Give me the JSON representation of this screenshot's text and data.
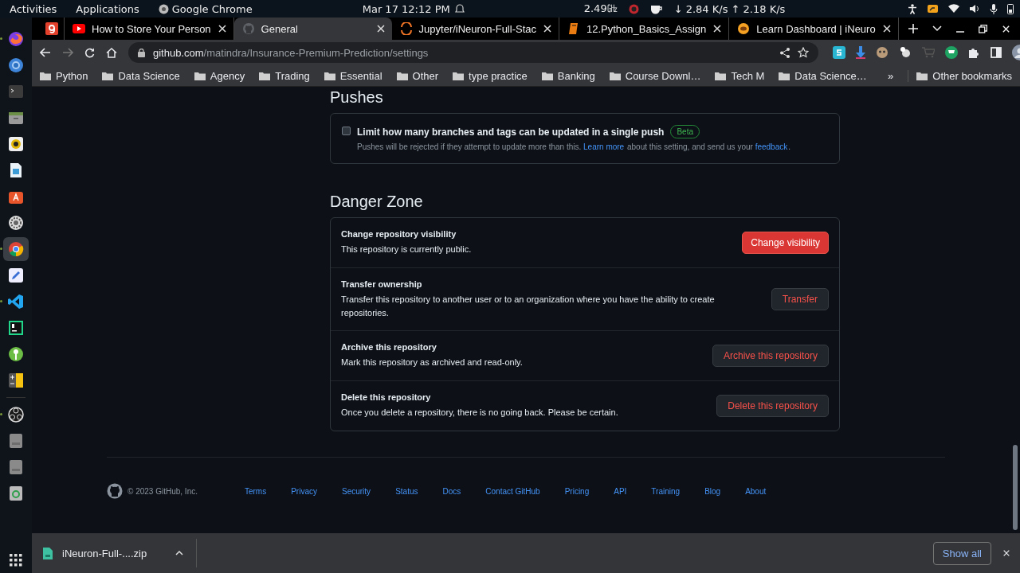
{
  "system_bar": {
    "menus": [
      "Activities",
      "Applications"
    ],
    "app": "Google Chrome",
    "clock": "Mar 17  12:12 PM",
    "cpu": "2.49㎓",
    "network": "↓ 2.84 K/s ↑ 2.18 K/s"
  },
  "dock": [
    {
      "kind": "fox",
      "running": true,
      "selected": false
    },
    {
      "kind": "globe",
      "running": false,
      "selected": false
    },
    {
      "kind": "terminal",
      "running": false,
      "selected": false
    },
    {
      "kind": "files",
      "running": false,
      "selected": false
    },
    {
      "kind": "speaker",
      "running": false,
      "selected": false
    },
    {
      "kind": "document",
      "running": false,
      "selected": false
    },
    {
      "kind": "store",
      "running": false,
      "selected": false
    },
    {
      "kind": "gear",
      "running": false,
      "selected": false
    },
    {
      "kind": "chrome",
      "running": true,
      "selected": true
    },
    {
      "kind": "pencil",
      "running": false,
      "selected": false
    },
    {
      "kind": "code",
      "running": true,
      "selected": false
    },
    {
      "kind": "ide",
      "running": false,
      "selected": false
    },
    {
      "kind": "key",
      "running": false,
      "selected": false
    },
    {
      "kind": "calculator",
      "running": false,
      "selected": false
    },
    {
      "kind": "record",
      "running": true,
      "selected": false
    },
    {
      "kind": "drive",
      "running": false,
      "selected": false
    },
    {
      "kind": "drive",
      "running": false,
      "selected": false
    },
    {
      "kind": "trash",
      "running": false,
      "selected": false
    }
  ],
  "tabs": [
    {
      "title": "How to Store Your Person",
      "kind": "video",
      "selected": false
    },
    {
      "title": "General",
      "kind": "cat",
      "selected": true
    },
    {
      "title": "Jupyter/iNeuron-Full-Stac",
      "kind": "arc",
      "selected": false
    },
    {
      "title": "12.Python_Basics_Assign",
      "kind": "book",
      "selected": false
    },
    {
      "title": "Learn Dashboard | iNeuro",
      "kind": "ring",
      "selected": false
    }
  ],
  "address": {
    "host": "github.com",
    "path": "/matindra/Insurance-Premium-Prediction/settings"
  },
  "bookmarks": [
    "Python",
    "Data Science",
    "Agency",
    "Trading",
    "Essential",
    "Other",
    "type practice",
    "Banking",
    "Course Downl…",
    "Tech M",
    "Data Science…"
  ],
  "bookmarks_overflow": "»",
  "other_bookmarks": "Other bookmarks",
  "pushes": {
    "heading": "Pushes",
    "label": "Limit how many branches and tags can be updated in a single push",
    "checked": false,
    "badge": "Beta",
    "description": [
      {
        "text": "Pushes will be rejected if they attempt to update more than this. ",
        "link": false
      },
      {
        "text": "Learn more",
        "link": true
      },
      {
        "text": " about this setting, and send us your ",
        "link": false
      },
      {
        "text": "feedback",
        "link": true
      },
      {
        "text": ".",
        "link": false
      }
    ]
  },
  "danger_zone": {
    "heading": "Danger Zone",
    "items": [
      {
        "title": "Change repository visibility",
        "description": "This repository is currently public.",
        "button": "Change visibility",
        "kind": "primary"
      },
      {
        "title": "Transfer ownership",
        "description": "Transfer this repository to another user or to an organization where you have the ability to create repositories.",
        "button": "Transfer",
        "kind": "outline"
      },
      {
        "title": "Archive this repository",
        "description": "Mark this repository as archived and read-only.",
        "button": "Archive this repository",
        "kind": "outline"
      },
      {
        "title": "Delete this repository",
        "description": "Once you delete a repository, there is no going back. Please be certain.",
        "button": "Delete this repository",
        "kind": "outline"
      }
    ]
  },
  "footer": {
    "copyright": "© 2023 GitHub, Inc.",
    "links": [
      "Terms",
      "Privacy",
      "Security",
      "Status",
      "Docs",
      "Contact GitHub",
      "Pricing",
      "API",
      "Training",
      "Blog",
      "About"
    ]
  },
  "downloads": {
    "items": [
      {
        "name": "iNeuron-Full-....zip"
      }
    ],
    "show_all": "Show all"
  }
}
